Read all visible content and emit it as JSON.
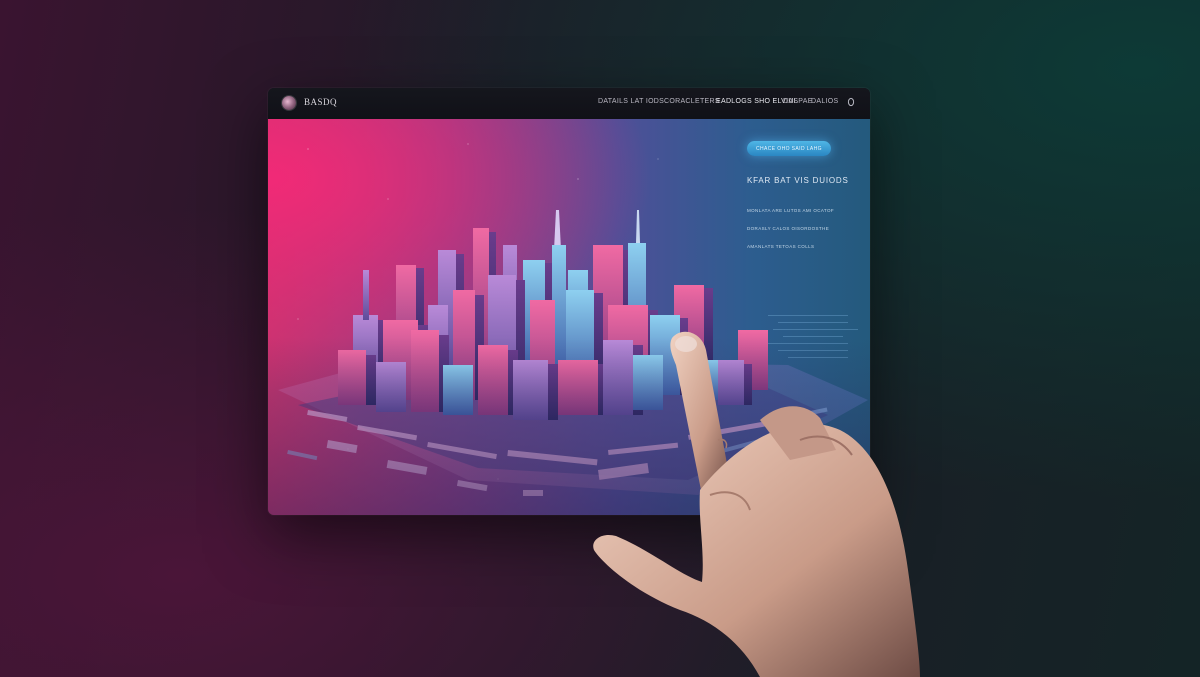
{
  "brand": {
    "name": "BASDQ"
  },
  "nav": {
    "links": [
      "DATAILS LAT IODS",
      "CORACLETERS",
      "EADLOGS SHO ELVIUL",
      "DASPAE",
      "DALIOS"
    ],
    "active_index": 2
  },
  "hero": {
    "cta_label": "CHACE OHO SAID LAHG",
    "headline": "KFAR BAT VIS  DUIODS",
    "body_lines": [
      "MONLATA ARE LUTOS AMI OCATOF",
      "DORASLY CALOS OISORDOSTHE",
      "AMANLATS TETOAS COLLS"
    ]
  },
  "colors": {
    "accent_pink": "#f12a77",
    "accent_blue": "#2a86c2",
    "topbar": "#121319"
  },
  "icons": {
    "logo": "circle-logo-icon",
    "search": "search-icon"
  }
}
